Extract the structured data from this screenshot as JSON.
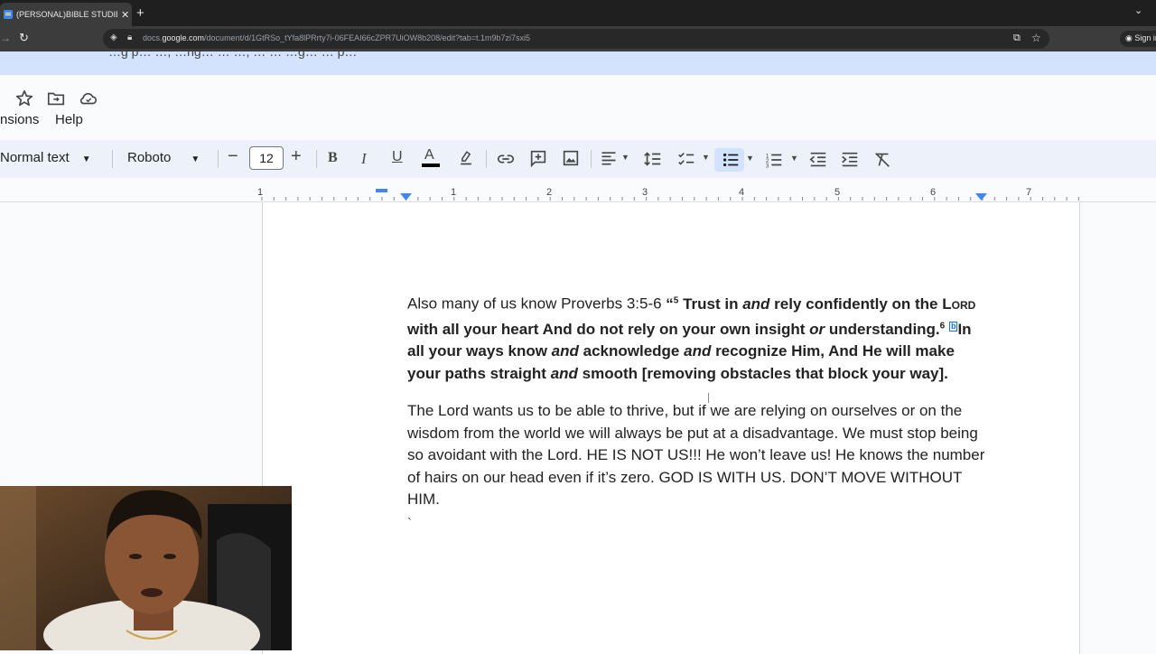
{
  "browser": {
    "tab_title": "(PERSONAL)BIBLE STUDIES WIT",
    "url_prefix": "docs.",
    "url_domain": "google.com",
    "url_path": "/document/d/1GtRSo_tYfa8lPRrty7i-06FEAI66cZPR7UiOW8b208/edit?tab=t.1m9b7zi7sxi5",
    "signin_label": "Sign in"
  },
  "banner": {
    "text": "…g p… …, …ng… … …, … … …g… … p…"
  },
  "menu": {
    "extensions_label": "nsions",
    "help_label": "Help"
  },
  "toolbar": {
    "style_value": "Normal text",
    "font_value": "Roboto",
    "font_size": "12",
    "minus": "−",
    "plus": "+"
  },
  "ruler": {
    "labels": [
      "1",
      "1",
      "2",
      "3",
      "4",
      "5",
      "6",
      "7"
    ]
  },
  "document": {
    "p1_intro": "Also many of us know Proverbs 3:5-6 ",
    "p1_quote": "“",
    "p1_sup5": "5",
    "p1_a": " Trust in ",
    "p1_and1": "and",
    "p1_b": " rely confidently on the ",
    "p1_lord": "Lord",
    "p1_c": " with all your heart And do not rely on your own insight ",
    "p1_or": "or",
    "p1_d": " understanding.",
    "p1_sup6": "6",
    "p1_fn": "b",
    "p1_e": "In all your ways know ",
    "p1_and2": "and",
    "p1_f": " acknowledge ",
    "p1_and3": "and",
    "p1_g": " recognize Him, And He will make your paths straight ",
    "p1_and4": "and",
    "p1_h": " smooth [removing obstacles that block your way].",
    "p2": "The Lord wants us to be able to thrive, but if we are relying on ourselves or on the wisdom from the world we will always be put at a disadvantage. We must stop being so avoidant with the Lord. HE IS NOT US!!! He won’t leave us! He knows the number of hairs on our head even if it’s zero. GOD IS WITH US. DON’T MOVE WITHOUT HIM.",
    "p3": "`"
  },
  "colors": {
    "accent": "#1a73e8",
    "toolbar_bg": "#edf2fa",
    "banner_bg": "#d3e3fd"
  }
}
